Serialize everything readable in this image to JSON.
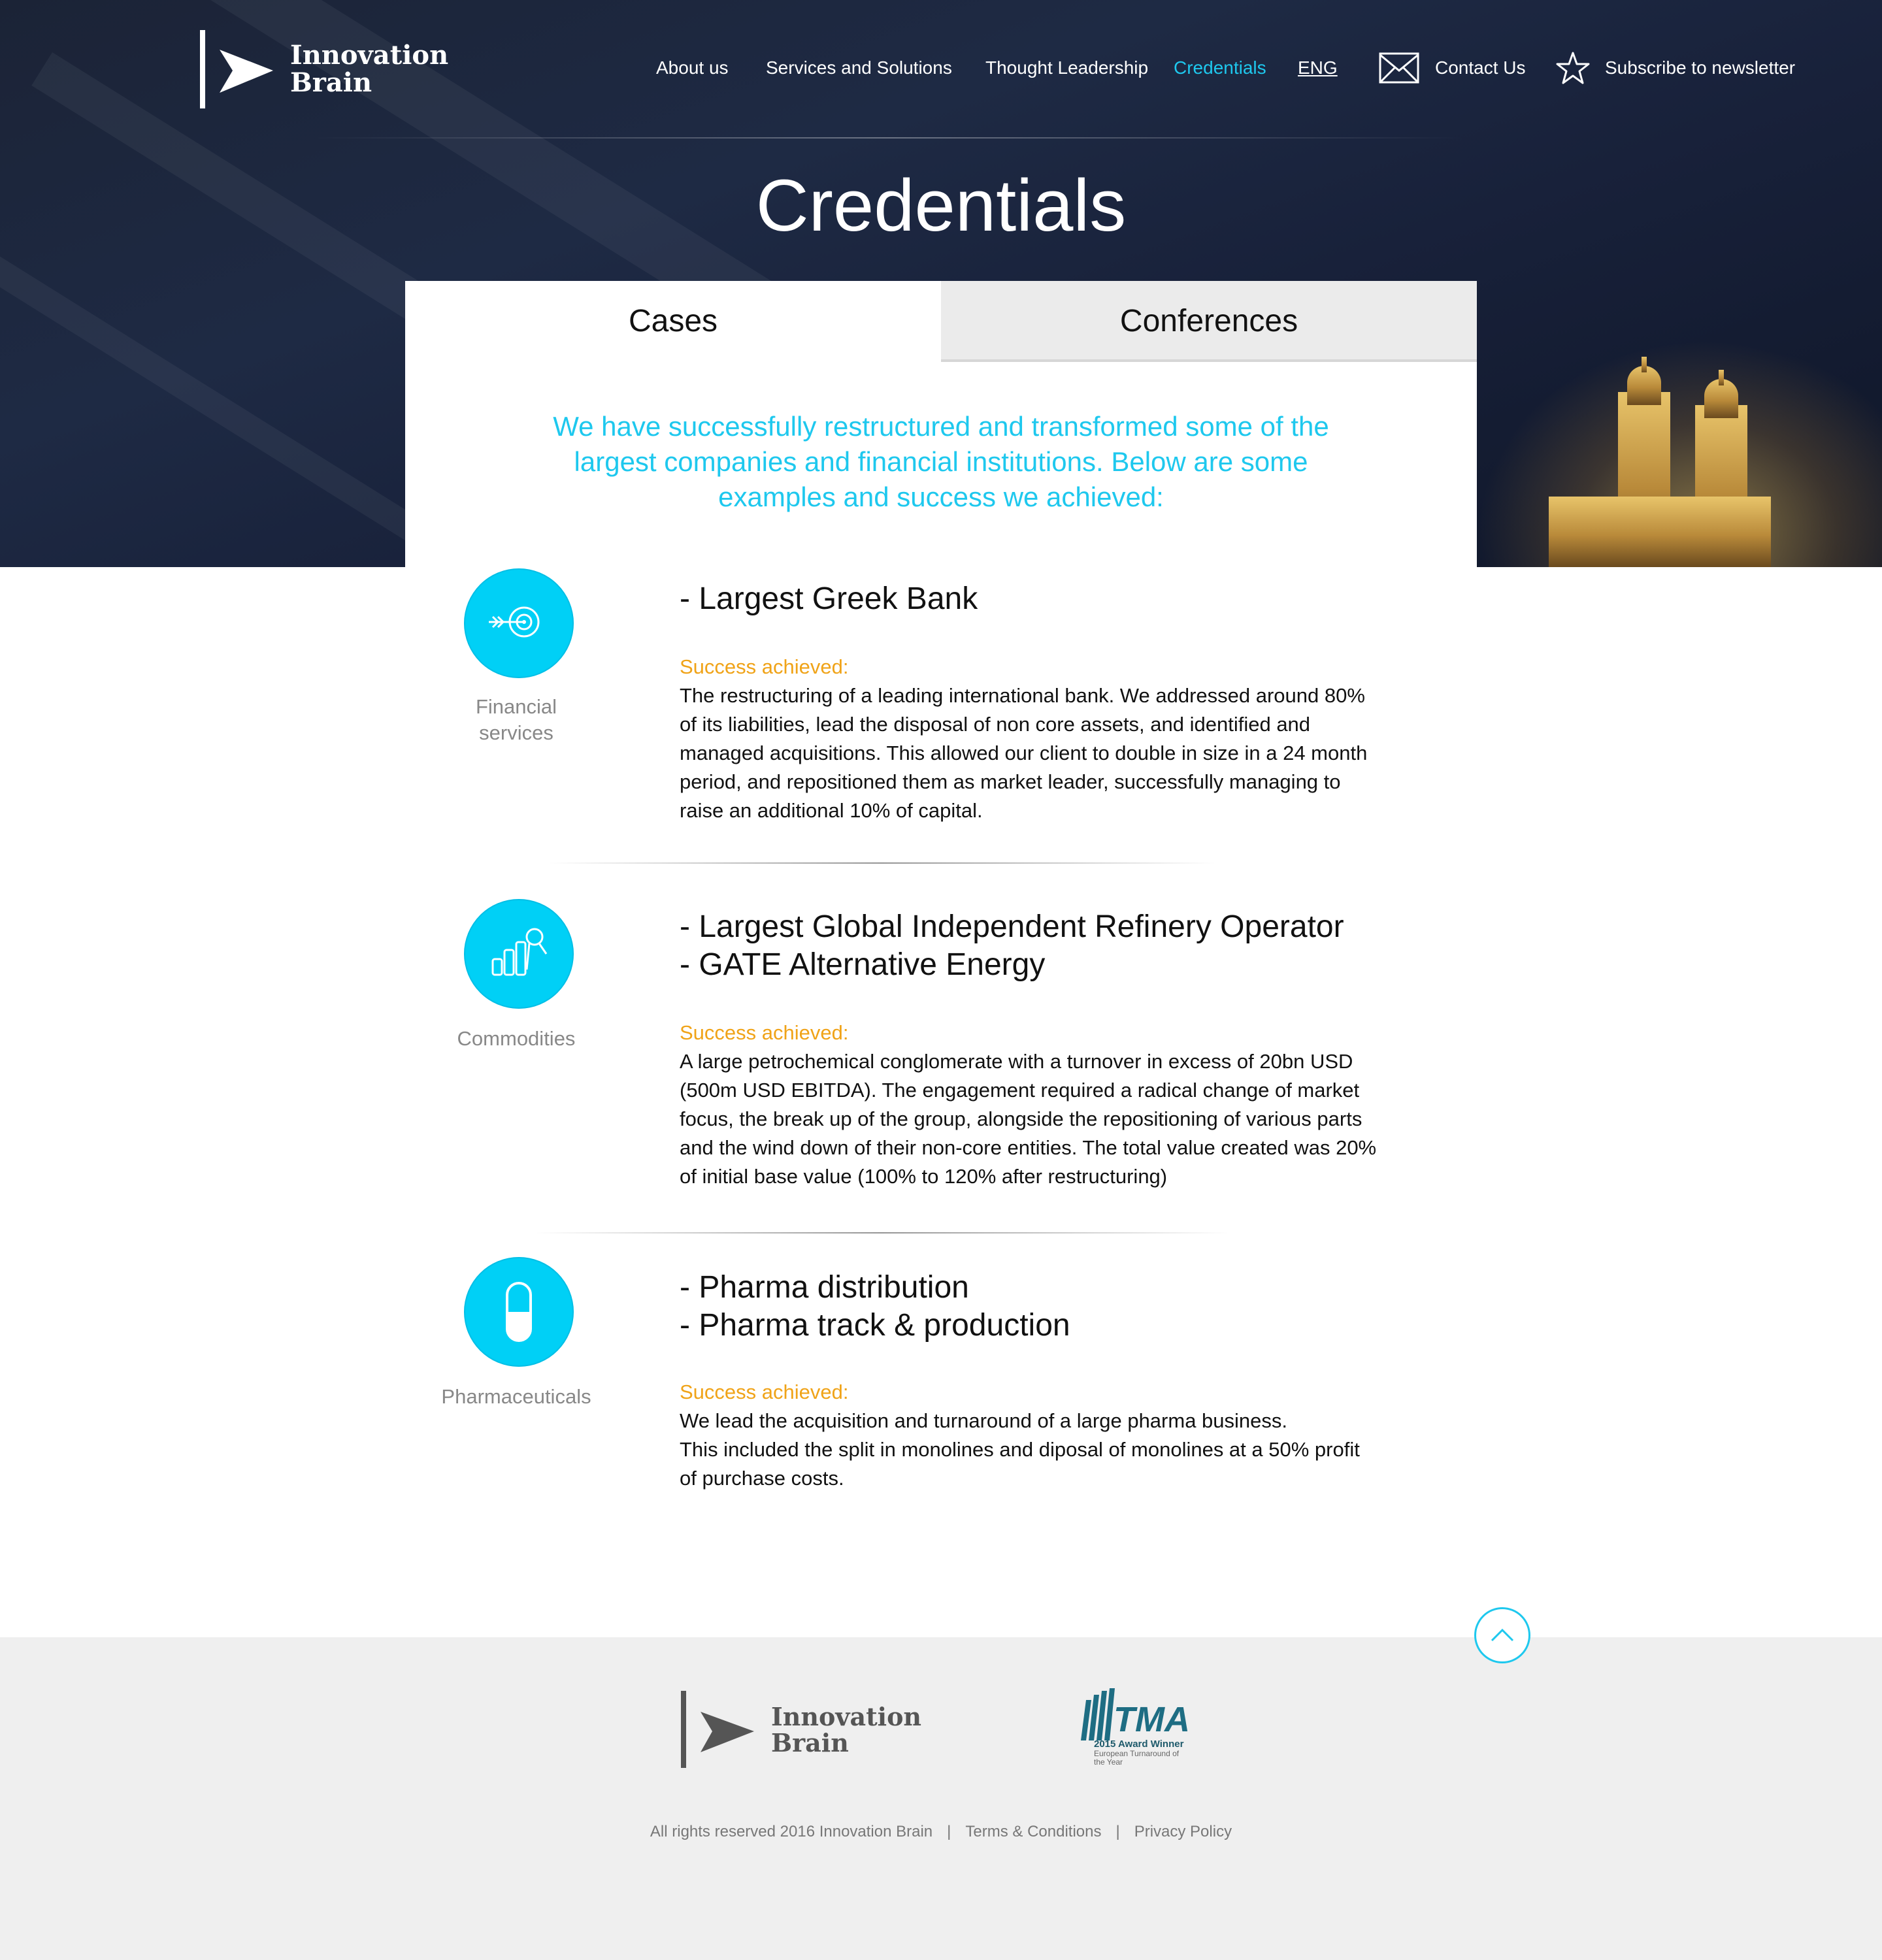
{
  "brand": {
    "name_line1": "Innovation",
    "name_line2": "Brain"
  },
  "nav": {
    "about": "About us",
    "services": "Services and Solutions",
    "thought": "Thought Leadership",
    "credentials": "Credentials",
    "lang": "ENG",
    "contact": "Contact Us",
    "subscribe": "Subscribe to newsletter",
    "contact_icon": "envelope-icon",
    "subscribe_icon": "star-icon"
  },
  "page_title": "Credentials",
  "tabs": [
    {
      "label": "Cases",
      "active": true
    },
    {
      "label": "Conferences",
      "active": false
    }
  ],
  "intro": "We have successfully restructured and transformed some of the largest companies and financial institutions. Below are some examples and success we achieved:",
  "cases": [
    {
      "icon": "target-arrow-icon",
      "category_line1": "Financial",
      "category_line2": "services",
      "title_line1": "- Largest Greek Bank",
      "title_line2": "",
      "success_label": "Success achieved:",
      "body_lines": [
        "The restructuring of a leading international bank. We addressed around 80%",
        "of its liabilities, lead the disposal of non core assets, and identified and",
        "managed acquisitions. This allowed our client to double in size in a 24 month",
        "period, and repositioned them as market leader, successfully managing to",
        "raise an additional 10% of capital."
      ]
    },
    {
      "icon": "bar-chart-search-icon",
      "category_line1": "Commodities",
      "category_line2": "",
      "title_line1": "- Largest Global Independent Refinery Operator",
      "title_line2": "- GATE Alternative Energy",
      "success_label": "Success achieved:",
      "body_lines": [
        "A large petrochemical conglomerate with a turnover in excess of 20bn USD",
        "(500m USD EBITDA). The engagement required a radical change of market",
        "focus, the break up of the group, alongside the repositioning of various parts",
        "and the wind down of their non-core entities. The total value created was 20%",
        "of initial base value (100% to 120% after restructuring)"
      ]
    },
    {
      "icon": "pill-capsule-icon",
      "category_line1": "Pharmaceuticals",
      "category_line2": "",
      "title_line1": "- Pharma distribution",
      "title_line2": "- Pharma track & production",
      "success_label": "Success achieved:",
      "body_lines": [
        "We lead the acquisition and turnaround of a large pharma business.",
        "This included the split in monolines and diposal of monolines at a 50% profit",
        "of purchase costs."
      ]
    }
  ],
  "footer": {
    "tma_letters": "TMA",
    "tma_award": "2015 Award Winner",
    "tma_sub": "European Turnaround of the Year",
    "copyright": "All rights reserved 2016 Innovation Brain",
    "terms": "Terms & Conditions",
    "privacy": "Privacy Policy",
    "to_top_icon": "chevron-up-icon"
  },
  "colors": {
    "accent": "#1ec8ee",
    "icon_bg": "#00d0f6",
    "success": "#f0a318",
    "hero_bg": "#1b2336",
    "footer_bg": "#efefef"
  }
}
